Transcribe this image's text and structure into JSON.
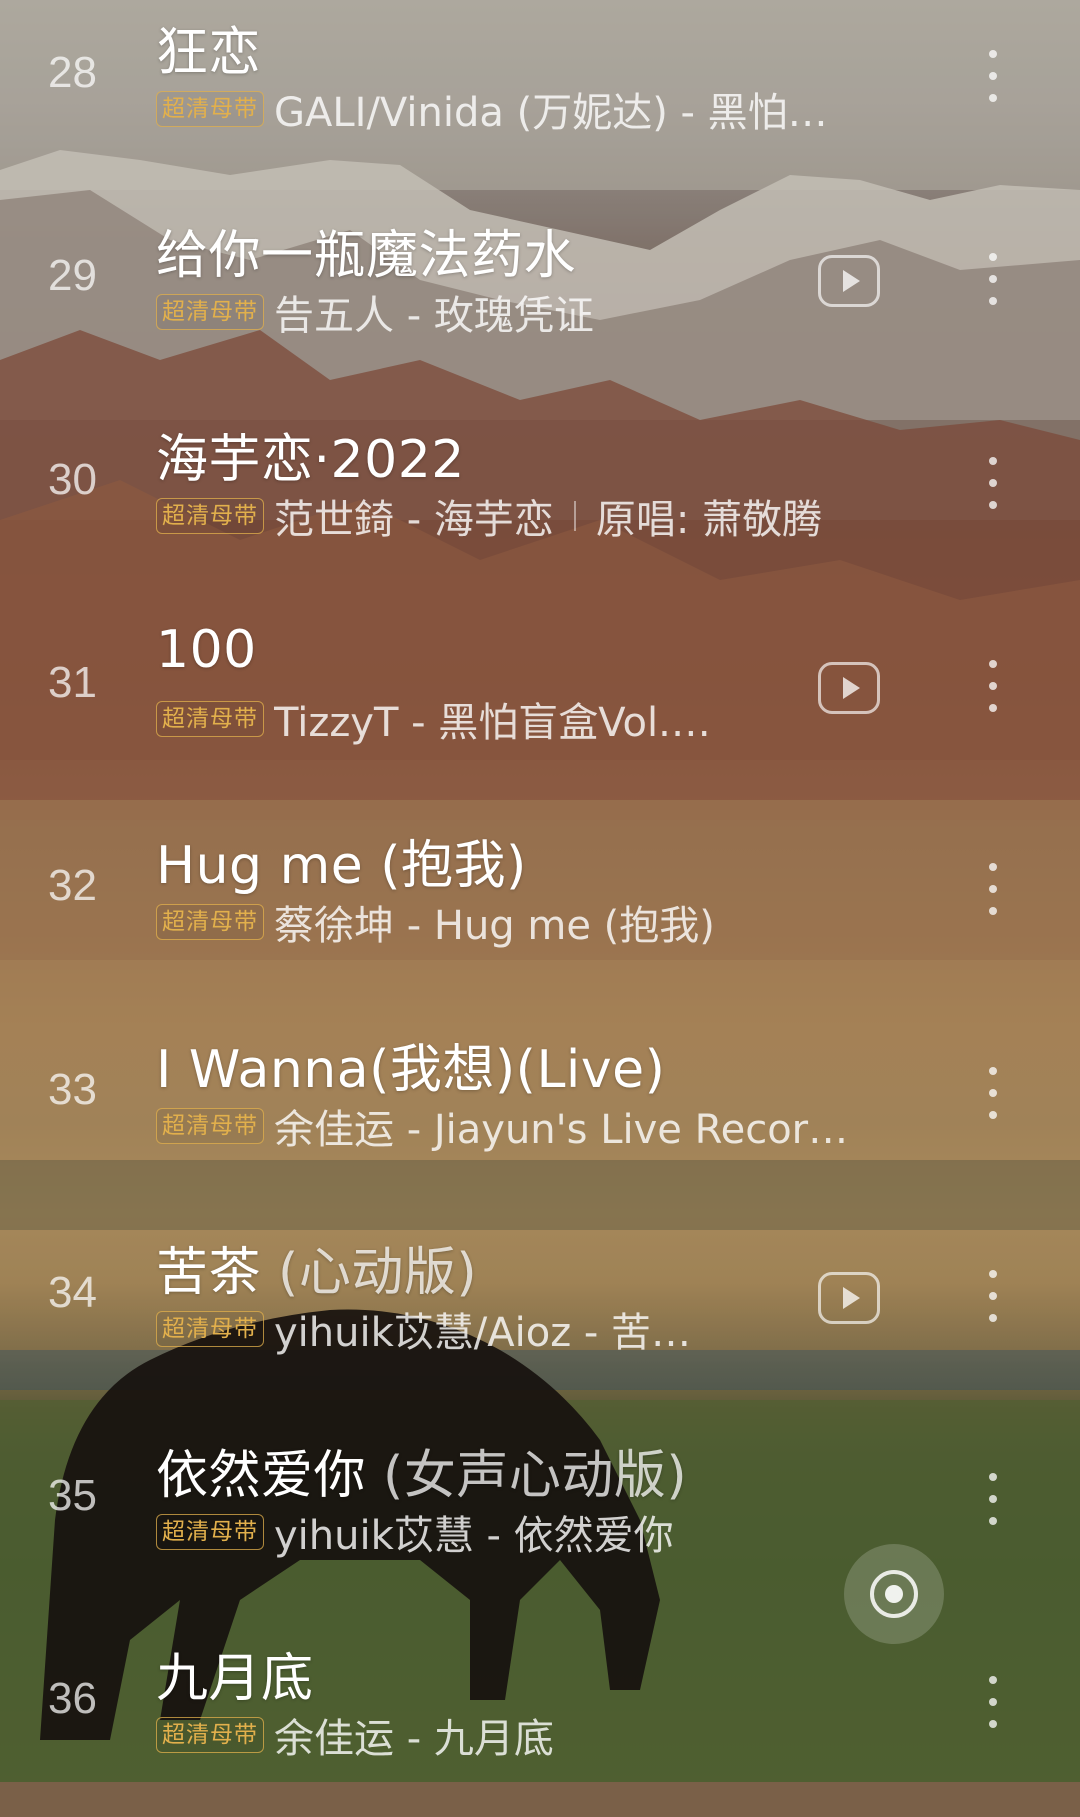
{
  "badge_label": "超清母带",
  "songs": [
    {
      "rank": "28",
      "title": "狂恋",
      "title_sub": "",
      "desc": "GALI/Vinida (万妮达) - 黑怕…",
      "desc_extra": "",
      "has_mv": false
    },
    {
      "rank": "29",
      "title": "给你一瓶魔法药水",
      "title_sub": "",
      "desc": "告五人 - 玫瑰凭证",
      "desc_extra": "",
      "has_mv": true
    },
    {
      "rank": "30",
      "title": "海芋恋·2022",
      "title_sub": "",
      "desc": "范世錡 - 海芋恋",
      "desc_extra": "原唱: 萧敬腾",
      "has_mv": false
    },
    {
      "rank": "31",
      "title": "100",
      "title_sub": "",
      "desc": "TizzyT - 黑怕盲盒Vol.…",
      "desc_extra": "",
      "has_mv": true
    },
    {
      "rank": "32",
      "title": "Hug me (抱我)",
      "title_sub": "",
      "desc": "蔡徐坤 - Hug me (抱我)",
      "desc_extra": "",
      "has_mv": false
    },
    {
      "rank": "33",
      "title": "I Wanna(我想)(Live)",
      "title_sub": "",
      "desc": "余佳运 - Jiayun's Live Recor…",
      "desc_extra": "",
      "has_mv": false
    },
    {
      "rank": "34",
      "title": "苦茶",
      "title_sub": "(心动版)",
      "desc": "yihuik苡慧/Aioz - 苦…",
      "desc_extra": "",
      "has_mv": true
    },
    {
      "rank": "35",
      "title": "依然爱你",
      "title_sub": "(女声心动版)",
      "desc": "yihuik苡慧 - 依然爱你",
      "desc_extra": "",
      "has_mv": false
    },
    {
      "rank": "36",
      "title": "九月底",
      "title_sub": "",
      "desc": "余佳运 - 九月底",
      "desc_extra": "",
      "has_mv": false
    }
  ],
  "icons": {
    "mv": "play-video-icon",
    "more": "more-vertical-icon",
    "locate": "locate-current-icon"
  },
  "colors": {
    "badge": "#e2b04c",
    "title": "#ffffff"
  }
}
